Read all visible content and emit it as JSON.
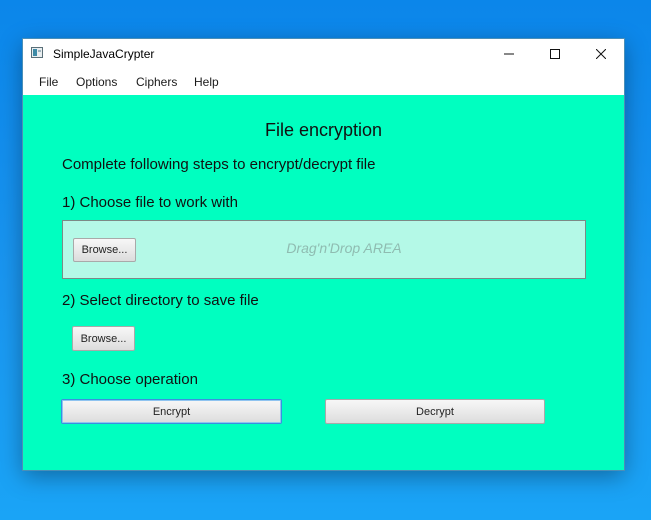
{
  "window": {
    "title": "SimpleJavaCrypter"
  },
  "menu": {
    "items": [
      {
        "label": "File"
      },
      {
        "label": "Options"
      },
      {
        "label": "Ciphers"
      },
      {
        "label": "Help"
      }
    ]
  },
  "main": {
    "heading": "File encryption",
    "instructions": "Complete following steps to encrypt/decrypt file",
    "step1_label": "1) Choose file to work with",
    "drop_area_text": "Drag'n'Drop AREA",
    "browse_file_label": "Browse...",
    "step2_label": "2) Select directory to save file",
    "browse_dir_label": "Browse...",
    "step3_label": "3) Choose operation",
    "encrypt_label": "Encrypt",
    "decrypt_label": "Decrypt"
  },
  "colors": {
    "content_background": "#00ffc0",
    "drop_area_background": "#b4f9e7",
    "desktop_background": "#1a96f0",
    "focus_border": "#3b8fe0"
  },
  "icons": {
    "app": "app-window-icon",
    "minimize": "minimize-icon",
    "maximize": "maximize-icon",
    "close": "close-icon"
  }
}
